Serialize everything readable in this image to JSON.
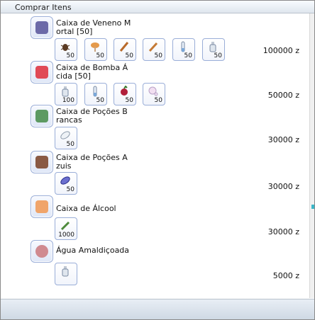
{
  "window": {
    "title": "Comprar Itens"
  },
  "items": [
    {
      "name": "Caixa de Veneno M\nortal [50]",
      "price": "100000 z",
      "box_color": "#6c6aa8",
      "contents": [
        {
          "icon": "insect-icon",
          "qty": "50"
        },
        {
          "icon": "mushroom-icon",
          "qty": "50"
        },
        {
          "icon": "herb-stick-icon",
          "qty": "50"
        },
        {
          "icon": "knife-icon",
          "qty": "50"
        },
        {
          "icon": "test-tube-icon",
          "qty": "50"
        },
        {
          "icon": "bottle-icon",
          "qty": "50"
        }
      ]
    },
    {
      "name": "Caixa de Bomba Á\ncida [50]",
      "price": "50000 z",
      "box_color": "#e04a56",
      "contents": [
        {
          "icon": "bottle-icon",
          "qty": "100"
        },
        {
          "icon": "test-tube-icon",
          "qty": "50"
        },
        {
          "icon": "berry-icon",
          "qty": "50"
        },
        {
          "icon": "bubble-icon",
          "qty": "50"
        }
      ]
    },
    {
      "name": "Caixa de Poções B\nrancas",
      "price": "30000 z",
      "box_color": "#5d9a62",
      "contents": [
        {
          "icon": "white-leaf-icon",
          "qty": "50"
        }
      ]
    },
    {
      "name": "Caixa de Poções A\nzuis",
      "price": "30000 z",
      "box_color": "#8a5a44",
      "contents": [
        {
          "icon": "blue-leaf-icon",
          "qty": "50"
        }
      ]
    },
    {
      "name": "Caixa de Álcool",
      "price": "30000 z",
      "box_color": "#f0a46a",
      "contents": [
        {
          "icon": "green-twig-icon",
          "qty": "1000"
        }
      ]
    },
    {
      "name": "Água Amaldiçoada",
      "price": "5000 z",
      "box_color": "#d08a90",
      "contents": [
        {
          "icon": "bottle-icon",
          "qty": ""
        }
      ]
    }
  ]
}
